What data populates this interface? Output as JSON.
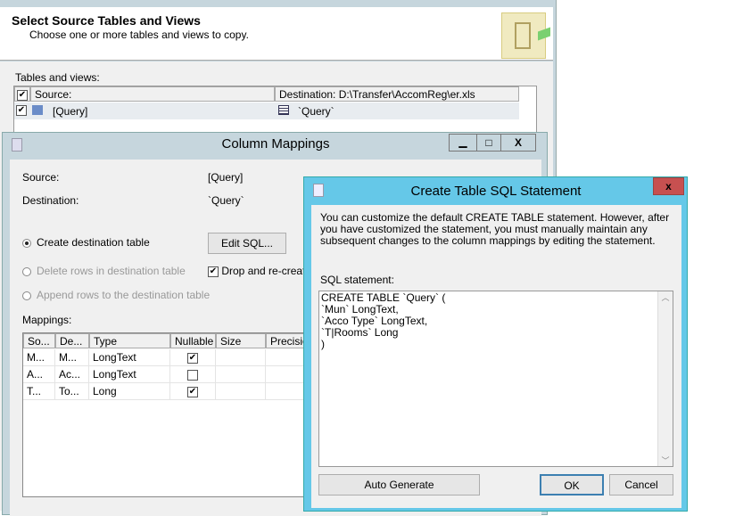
{
  "wizard": {
    "title": "Select Source Tables and Views",
    "subtitle": "Choose one or more tables and views to copy.",
    "tables_label": "Tables and views:",
    "col_source": "Source:",
    "col_destination": "Destination: D:\\Transfer\\AccomReg\\er.xls",
    "row_source": "[Query]",
    "row_destination": "`Query`"
  },
  "mappings": {
    "title": "Column Mappings",
    "source_label": "Source:",
    "source_value": "[Query]",
    "dest_label": "Destination:",
    "dest_value": "`Query`",
    "opt_create": "Create destination table",
    "opt_delete": "Delete rows in destination table",
    "opt_append": "Append rows to the destination table",
    "edit_sql": "Edit SQL...",
    "drop_recreate": "Drop and re-create",
    "mappings_label": "Mappings:",
    "columns": [
      "So...",
      "De...",
      "Type",
      "Nullable",
      "Size",
      "Precision"
    ],
    "rows": [
      {
        "src": "M...",
        "dst": "M...",
        "type": "LongText",
        "nullable": true
      },
      {
        "src": "A...",
        "dst": "Ac...",
        "type": "LongText",
        "nullable": false
      },
      {
        "src": "T...",
        "dst": "To...",
        "type": "Long",
        "nullable": true
      }
    ]
  },
  "sql": {
    "title": "Create Table SQL Statement",
    "description": "You can customize the default CREATE TABLE statement. However, after you have customized the statement, you must manually maintain any subsequent changes to the column mappings by editing the statement.",
    "label": "SQL statement:",
    "statement": "CREATE TABLE `Query` (\n`Mun` LongText,\n`Acco Type` LongText,\n`T|Rooms` Long\n)",
    "auto_generate": "Auto Generate",
    "ok": "OK",
    "cancel": "Cancel"
  }
}
